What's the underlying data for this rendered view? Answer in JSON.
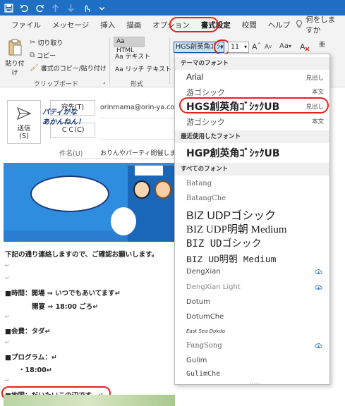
{
  "quick_access": {
    "icons": [
      "save-icon",
      "undo-icon",
      "redo-icon",
      "up-icon",
      "down-icon",
      "touch-icon",
      "dropdown-icon"
    ]
  },
  "tabs": [
    {
      "label": "ファイル"
    },
    {
      "label": "メッセージ"
    },
    {
      "label": "挿入"
    },
    {
      "label": "描画"
    },
    {
      "label": "オプション"
    },
    {
      "label": "書式設定"
    },
    {
      "label": "校閲"
    },
    {
      "label": "ヘルプ"
    }
  ],
  "tell_me": {
    "label": "何をしますか",
    "icon": "lightbulb-icon"
  },
  "ribbon": {
    "paste_label": "貼り付け",
    "cut_label": "切り取り",
    "copy_label": "コピー",
    "format_painter_label": "書式のコピー/貼り付け",
    "clipboard_group": "クリップボード",
    "html_label": "HTML",
    "text_label": "テキスト",
    "richtext_label": "リッチ テキスト",
    "format_group": "形式",
    "aa_prefix": "Aa",
    "font_name": "HGS創英角ｺﾞｼｯｸ",
    "font_size": "11",
    "grow_font": "A",
    "shrink_font": "A",
    "change_case": "Aa",
    "grow_shrink_label": "亜"
  },
  "message": {
    "send_label": "送信",
    "send_shortcut": "(S)",
    "to_button": "宛先(T)",
    "to_value": "orinmama@orin-ya.co...",
    "cc_button": "ＣＣ(C)",
    "subject_label": "件名(U)",
    "subject_value": "おりんやパーティ開催します",
    "banner_text_line1": "パティかな",
    "banner_text_line2": "あかんねん！"
  },
  "body_lines": [
    {
      "text": "下記の通り連絡しますので、ご確認お願いします。",
      "bold": true
    },
    {
      "text": "↵",
      "bold": false
    },
    {
      "text": "↵",
      "bold": false
    },
    {
      "text": "■時間：開場 ⇒ いつでもあいてます↵",
      "bold": true
    },
    {
      "text": "　　　　開宴 ⇒ 18:00 ごろ↵",
      "bold": true
    },
    {
      "text": "↵",
      "bold": false
    },
    {
      "text": "■会費：タダ↵",
      "bold": true
    },
    {
      "text": "↵",
      "bold": false
    },
    {
      "text": "■プログラム：↵",
      "bold": true
    },
    {
      "text": "　　・18:00↵",
      "bold": true
    },
    {
      "text": "↵",
      "bold": false
    },
    {
      "text": "■地図：だいたいこの辺です。↵",
      "bold": true
    }
  ],
  "font_dropdown": {
    "theme_header": "テーマのフォント",
    "theme_fonts": [
      {
        "name": "Arial",
        "tag": "見出し"
      },
      {
        "name": "游ゴシック",
        "tag": "本文"
      },
      {
        "name": "HGS創英角ｺﾞｼｯｸUB",
        "tag": "見出し"
      },
      {
        "name": "游ゴシック",
        "tag": "本文"
      }
    ],
    "recent_header": "最近使用したフォント",
    "recent_fonts": [
      {
        "name": "HGP創英角ｺﾞｼｯｸUB"
      }
    ],
    "all_header": "すべてのフォント",
    "all_fonts": [
      {
        "name": "Batang",
        "cloud": false
      },
      {
        "name": "BatangChe",
        "cloud": false
      },
      {
        "name": "BIZ UDPゴシック",
        "cloud": false
      },
      {
        "name": "BIZ UDP明朝 Medium",
        "cloud": false
      },
      {
        "name": "BIZ UDゴシック",
        "cloud": false
      },
      {
        "name": "BIZ UD明朝 Medium",
        "cloud": false
      },
      {
        "name": "DengXian",
        "cloud": true
      },
      {
        "name": "DengXian Light",
        "cloud": true
      },
      {
        "name": "Dotum",
        "cloud": false
      },
      {
        "name": "DotumChe",
        "cloud": false
      },
      {
        "name": "East Sea Dokdo",
        "cloud": false
      },
      {
        "name": "FangSong",
        "cloud": true
      },
      {
        "name": "Gulim",
        "cloud": false
      },
      {
        "name": "GulimChe",
        "cloud": false
      }
    ],
    "more_indicator": "....."
  },
  "colors": {
    "title_blue": "#1f6fc5",
    "highlight_red": "#e2231a",
    "banner_blue": "#2f8de0"
  }
}
